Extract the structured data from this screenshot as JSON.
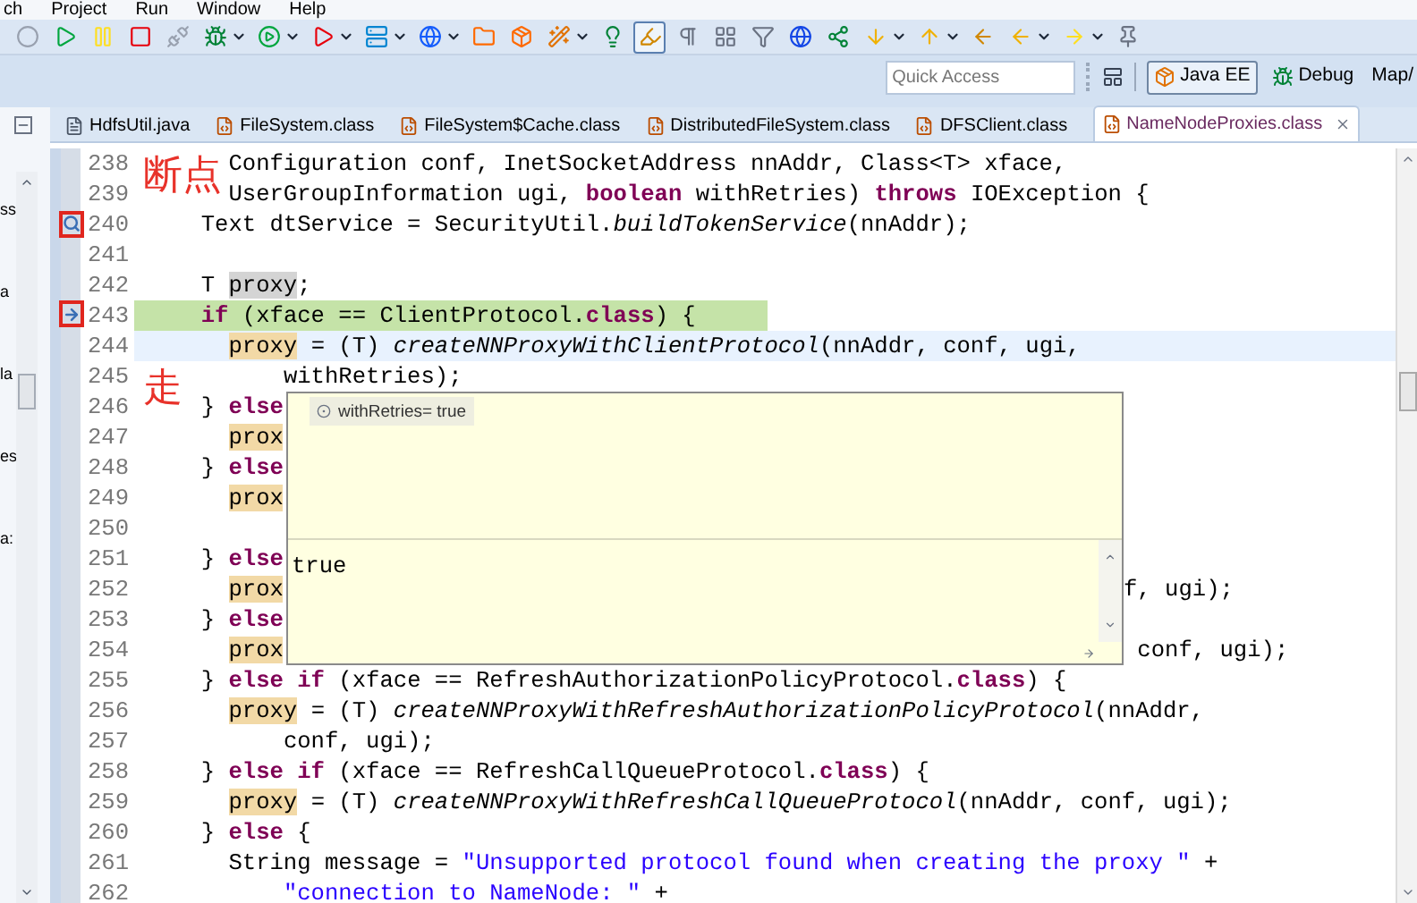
{
  "menu": [
    "ch",
    "Project",
    "Run",
    "Window",
    "Help"
  ],
  "toolbar": [
    {
      "kind": "skip",
      "selected": false,
      "dropdown": false
    },
    {
      "kind": "resume",
      "selected": false,
      "dropdown": false
    },
    {
      "kind": "suspend",
      "selected": false,
      "dropdown": false
    },
    {
      "kind": "terminate",
      "selected": false,
      "dropdown": false
    },
    {
      "kind": "disconnect",
      "selected": false,
      "dropdown": false
    },
    {
      "kind": "debug",
      "selected": false,
      "dropdown": true
    },
    {
      "kind": "run",
      "selected": false,
      "dropdown": true
    },
    {
      "kind": "external",
      "selected": false,
      "dropdown": true
    },
    {
      "kind": "server",
      "selected": false,
      "dropdown": true
    },
    {
      "kind": "web",
      "selected": false,
      "dropdown": true
    },
    {
      "kind": "open_type",
      "selected": false,
      "dropdown": false
    },
    {
      "kind": "open_task",
      "selected": false,
      "dropdown": false
    },
    {
      "kind": "search",
      "selected": false,
      "dropdown": true
    },
    {
      "kind": "hint",
      "selected": false,
      "dropdown": false
    },
    {
      "kind": "highlight",
      "selected": true,
      "dropdown": false
    },
    {
      "kind": "whitespace",
      "selected": false,
      "dropdown": false
    },
    {
      "kind": "block",
      "selected": false,
      "dropdown": false
    },
    {
      "kind": "filter",
      "selected": false,
      "dropdown": false
    },
    {
      "kind": "globe",
      "selected": false,
      "dropdown": false
    },
    {
      "kind": "share",
      "selected": false,
      "dropdown": false
    },
    {
      "kind": "next",
      "selected": false,
      "dropdown": true
    },
    {
      "kind": "prev",
      "selected": false,
      "dropdown": true
    },
    {
      "kind": "back",
      "selected": false,
      "dropdown": false
    },
    {
      "kind": "back_plain",
      "selected": false,
      "dropdown": true
    },
    {
      "kind": "forward",
      "selected": false,
      "dropdown": true
    },
    {
      "kind": "pin",
      "selected": false,
      "dropdown": false
    }
  ],
  "quick_access": {
    "placeholder": "Quick Access"
  },
  "perspectives": [
    {
      "label": "Java EE",
      "kind": "javaee",
      "selected": true
    },
    {
      "label": "Debug",
      "kind": "debug",
      "selected": false
    },
    {
      "label": "Map/",
      "kind": "plain",
      "selected": false
    }
  ],
  "left_panel": {
    "fragments": [
      "ss",
      "a",
      "la",
      "es",
      "a:"
    ]
  },
  "tabs": [
    {
      "label": "HdfsUtil.java",
      "kind": "java",
      "selected": false
    },
    {
      "label": "FileSystem.class",
      "kind": "class",
      "selected": false
    },
    {
      "label": "FileSystem$Cache.class",
      "kind": "class",
      "selected": false
    },
    {
      "label": "DistributedFileSystem.class",
      "kind": "class",
      "selected": false
    },
    {
      "label": "DFSClient.class",
      "kind": "class",
      "selected": false
    },
    {
      "label": "NameNodeProxies.class",
      "kind": "class",
      "selected": true
    }
  ],
  "editor": {
    "lines": [
      {
        "number": "238",
        "kind": "plain",
        "current": false,
        "cursor": false,
        "note": "断点",
        "segments": [
          {
            "text": "    Configuration conf, InetSocketAddress nnAddr, Class<T> xface,",
            "kind": "plain"
          }
        ]
      },
      {
        "number": "239",
        "kind": "plain",
        "current": false,
        "cursor": false,
        "segments": [
          {
            "text": "    UserGroupInformation ugi, ",
            "kind": "plain"
          },
          {
            "text": "boolean",
            "kind": "keyword"
          },
          {
            "text": " withRetries) ",
            "kind": "plain"
          },
          {
            "text": "throws",
            "kind": "keyword"
          },
          {
            "text": " IOException {",
            "kind": "plain"
          }
        ]
      },
      {
        "number": "240",
        "kind": "breakpoint",
        "annotated": true,
        "current": false,
        "cursor": false,
        "segments": [
          {
            "text": "  Text dtService = SecurityUtil.",
            "kind": "plain"
          },
          {
            "text": "buildTokenService",
            "kind": "italic"
          },
          {
            "text": "(nnAddr);",
            "kind": "plain"
          }
        ]
      },
      {
        "number": "241",
        "kind": "plain",
        "current": false,
        "cursor": false
      },
      {
        "number": "242",
        "kind": "plain",
        "current": false,
        "cursor": false,
        "segments": [
          {
            "text": "  T ",
            "kind": "plain"
          },
          {
            "text": "proxy",
            "kind": "selected_occurrence"
          },
          {
            "text": ";",
            "kind": "plain"
          }
        ]
      },
      {
        "number": "243",
        "kind": "instruction_pointer",
        "annotated": true,
        "current": true,
        "cursor": false,
        "segments": [
          {
            "text": "  if",
            "kind": "keyword"
          },
          {
            "text": " (xface == ClientProtocol.",
            "kind": "plain"
          },
          {
            "text": "class",
            "kind": "keyword"
          },
          {
            "text": ") {",
            "kind": "plain"
          }
        ]
      },
      {
        "number": "244",
        "kind": "plain",
        "current": false,
        "cursor": true,
        "segments": [
          {
            "text": "    proxy",
            "kind": "occurrence"
          },
          {
            "text": " = (T) ",
            "kind": "plain"
          },
          {
            "text": "createNNProxyWithClientProtocol",
            "kind": "italic"
          },
          {
            "text": "(nnAddr, conf, ugi,",
            "kind": "plain"
          }
        ]
      },
      {
        "number": "245",
        "kind": "plain",
        "current": false,
        "cursor": false,
        "note": "走",
        "segments": [
          {
            "text": "        withRetries);",
            "kind": "plain"
          }
        ]
      },
      {
        "number": "246",
        "kind": "plain",
        "current": false,
        "cursor": false,
        "segments": [
          {
            "text": "  } ",
            "kind": "plain"
          },
          {
            "text": "else",
            "kind": "keyword"
          }
        ],
        "popup": {
          "variable": "withRetries= true",
          "value": "true"
        }
      },
      {
        "number": "247",
        "kind": "plain",
        "current": false,
        "cursor": false,
        "segments": [
          {
            "text": "    prox",
            "kind": "occurrence"
          }
        ]
      },
      {
        "number": "248",
        "kind": "plain",
        "current": false,
        "cursor": false,
        "segments": [
          {
            "text": "  } ",
            "kind": "plain"
          },
          {
            "text": "else",
            "kind": "keyword"
          }
        ]
      },
      {
        "number": "249",
        "kind": "plain",
        "current": false,
        "cursor": false,
        "segments": [
          {
            "text": "    prox",
            "kind": "occurrence"
          }
        ]
      },
      {
        "number": "250",
        "kind": "plain",
        "current": false,
        "cursor": false
      },
      {
        "number": "251",
        "kind": "plain",
        "current": false,
        "cursor": false,
        "segments": [
          {
            "text": "  } ",
            "kind": "plain"
          },
          {
            "text": "else",
            "kind": "keyword"
          }
        ]
      },
      {
        "number": "252",
        "kind": "plain",
        "current": false,
        "cursor": false,
        "segments": [
          {
            "text": "    prox",
            "kind": "occurrence"
          }
        ],
        "tail": "f, ugi);"
      },
      {
        "number": "253",
        "kind": "plain",
        "current": false,
        "cursor": false,
        "segments": [
          {
            "text": "  } ",
            "kind": "plain"
          },
          {
            "text": "else",
            "kind": "keyword"
          }
        ]
      },
      {
        "number": "254",
        "kind": "plain",
        "current": false,
        "cursor": false,
        "segments": [
          {
            "text": "    prox",
            "kind": "occurrence"
          }
        ],
        "tail": " conf, ugi);"
      },
      {
        "number": "255",
        "kind": "plain",
        "current": false,
        "cursor": false,
        "segments": [
          {
            "text": "  } ",
            "kind": "plain"
          },
          {
            "text": "else if",
            "kind": "keyword"
          },
          {
            "text": " (xface == RefreshAuthorizationPolicyProtocol.",
            "kind": "plain"
          },
          {
            "text": "class",
            "kind": "keyword"
          },
          {
            "text": ") {",
            "kind": "plain"
          }
        ]
      },
      {
        "number": "256",
        "kind": "plain",
        "current": false,
        "cursor": false,
        "segments": [
          {
            "text": "    proxy",
            "kind": "occurrence"
          },
          {
            "text": " = (T) ",
            "kind": "plain"
          },
          {
            "text": "createNNProxyWithRefreshAuthorizationPolicyProtocol",
            "kind": "italic"
          },
          {
            "text": "(nnAddr,",
            "kind": "plain"
          }
        ]
      },
      {
        "number": "257",
        "kind": "plain",
        "current": false,
        "cursor": false,
        "segments": [
          {
            "text": "        conf, ugi);",
            "kind": "plain"
          }
        ]
      },
      {
        "number": "258",
        "kind": "plain",
        "current": false,
        "cursor": false,
        "segments": [
          {
            "text": "  } ",
            "kind": "plain"
          },
          {
            "text": "else if",
            "kind": "keyword"
          },
          {
            "text": " (xface == RefreshCallQueueProtocol.",
            "kind": "plain"
          },
          {
            "text": "class",
            "kind": "keyword"
          },
          {
            "text": ") {",
            "kind": "plain"
          }
        ]
      },
      {
        "number": "259",
        "kind": "plain",
        "current": false,
        "cursor": false,
        "segments": [
          {
            "text": "    proxy",
            "kind": "occurrence"
          },
          {
            "text": " = (T) ",
            "kind": "plain"
          },
          {
            "text": "createNNProxyWithRefreshCallQueueProtocol",
            "kind": "italic"
          },
          {
            "text": "(nnAddr, conf, ugi);",
            "kind": "plain"
          }
        ]
      },
      {
        "number": "260",
        "kind": "plain",
        "current": false,
        "cursor": false,
        "segments": [
          {
            "text": "  } ",
            "kind": "plain"
          },
          {
            "text": "else",
            "kind": "keyword"
          },
          {
            "text": " {",
            "kind": "plain"
          }
        ]
      },
      {
        "number": "261",
        "kind": "plain",
        "current": false,
        "cursor": false,
        "segments": [
          {
            "text": "    String message = ",
            "kind": "plain"
          },
          {
            "text": "\"Unsupported protocol found when creating the proxy \"",
            "kind": "string"
          },
          {
            "text": " +",
            "kind": "plain"
          }
        ]
      },
      {
        "number": "262",
        "kind": "plain",
        "current": false,
        "cursor": false,
        "segments": [
          {
            "text": "        \"connection to NameNode: \"",
            "kind": "string"
          },
          {
            "text": " +",
            "kind": "plain"
          }
        ]
      }
    ]
  }
}
